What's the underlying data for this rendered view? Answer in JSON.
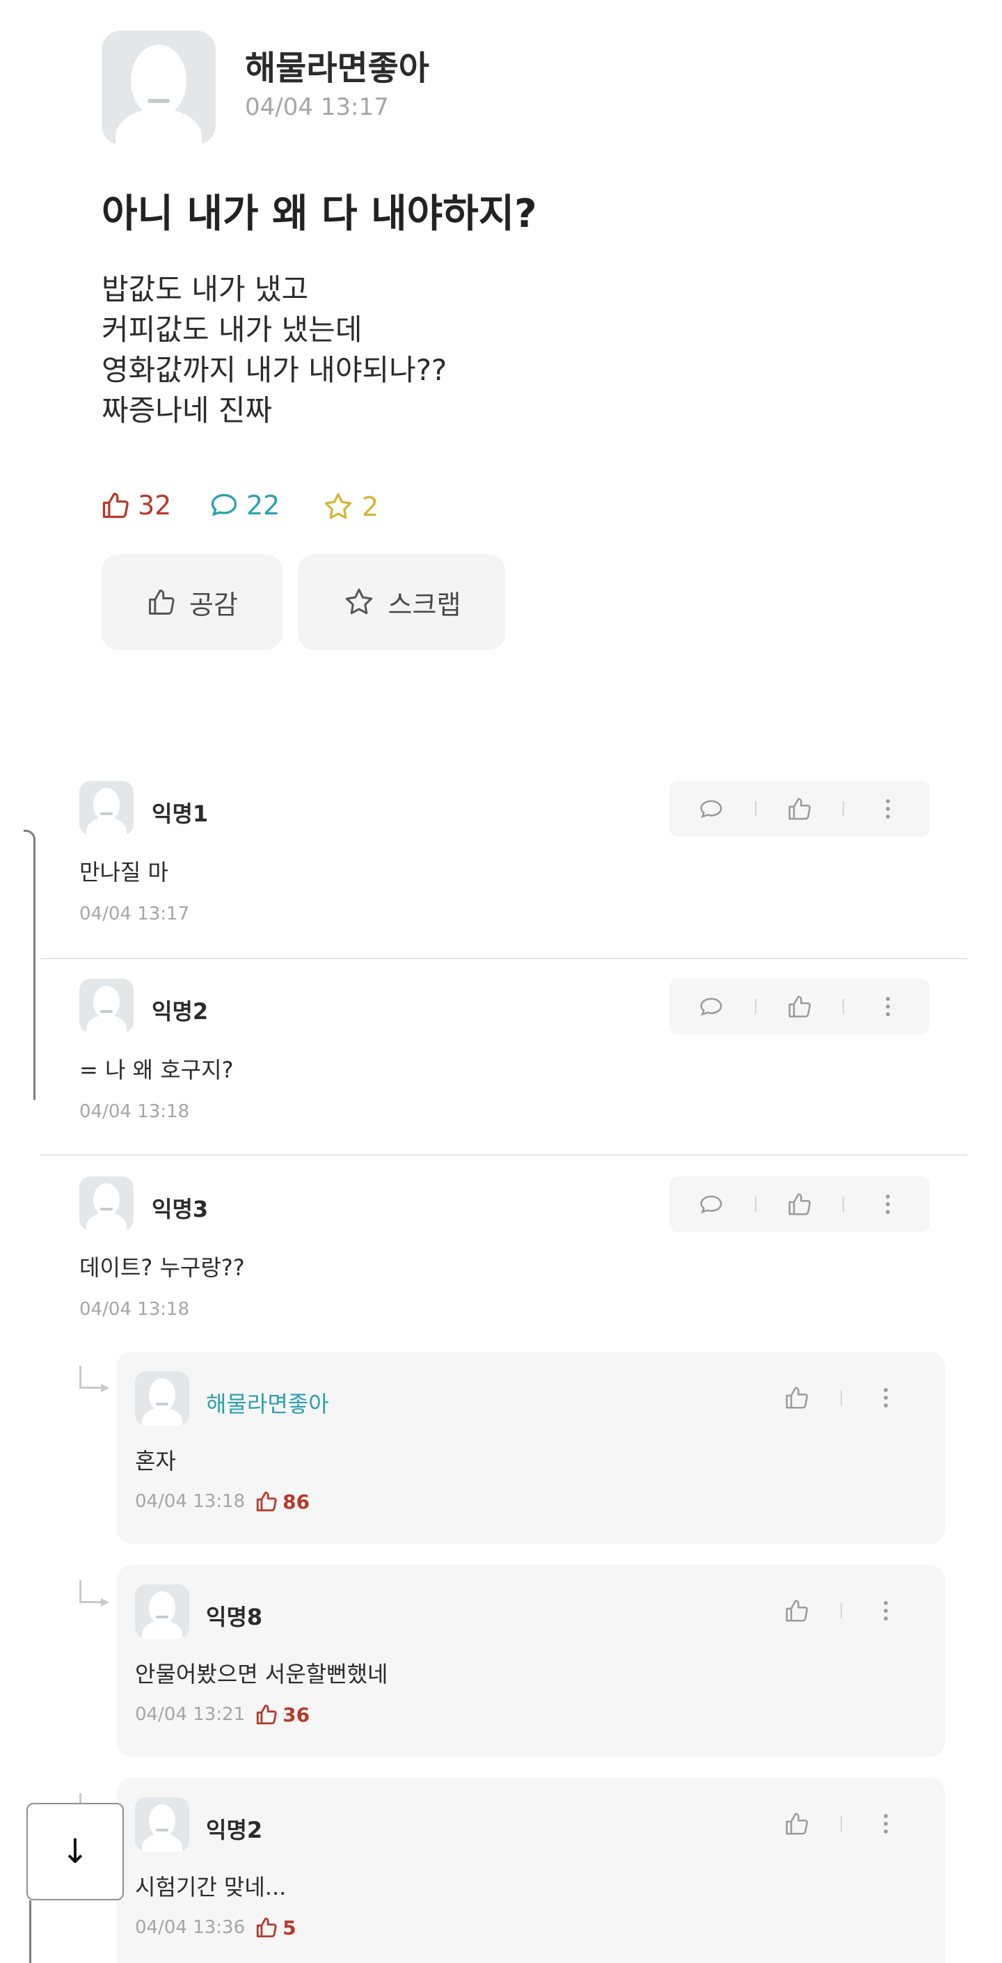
{
  "post": {
    "author": "해물라면좋아",
    "time": "04/04 13:17",
    "title": "아니 내가 왜 다 내야하지?",
    "body": [
      "밥값도 내가 냈고",
      "커피값도 내가 냈는데",
      "영화값까지 내가 내야되나??",
      "짜증나네 진짜"
    ],
    "stats": {
      "likes": "32",
      "comments": "22",
      "scraps": "2"
    },
    "buttons": {
      "like": "공감",
      "scrap": "스크랩"
    }
  },
  "comments": [
    {
      "name": "익명1",
      "text": "만나질 마",
      "time": "04/04 13:17"
    },
    {
      "name": "익명2",
      "text": "= 나 왜 호구지?",
      "time": "04/04 13:18"
    },
    {
      "name": "익명3",
      "text": "데이트? 누구랑??",
      "time": "04/04 13:18"
    }
  ],
  "replies": [
    {
      "name": "해물라면좋아",
      "text": "혼자",
      "time": "04/04 13:18",
      "likes": "86"
    },
    {
      "name": "익명8",
      "text": "안물어봤으면 서운할뻔했네",
      "time": "04/04 13:21",
      "likes": "36"
    },
    {
      "name": "익명2",
      "text": "시험기간 맞네...",
      "time": "04/04 13:36",
      "likes": "5"
    }
  ],
  "scroll_button": "↓",
  "colors": {
    "like": "#b73a2b",
    "comment": "#2aa0b0",
    "scrap": "#d7b534",
    "author": "#2aa0b0"
  },
  "icons": [
    "thumbs-up-icon",
    "speech-bubble-icon",
    "star-icon",
    "more-vertical-icon",
    "reply-arrow-icon",
    "arrow-down-icon"
  ]
}
